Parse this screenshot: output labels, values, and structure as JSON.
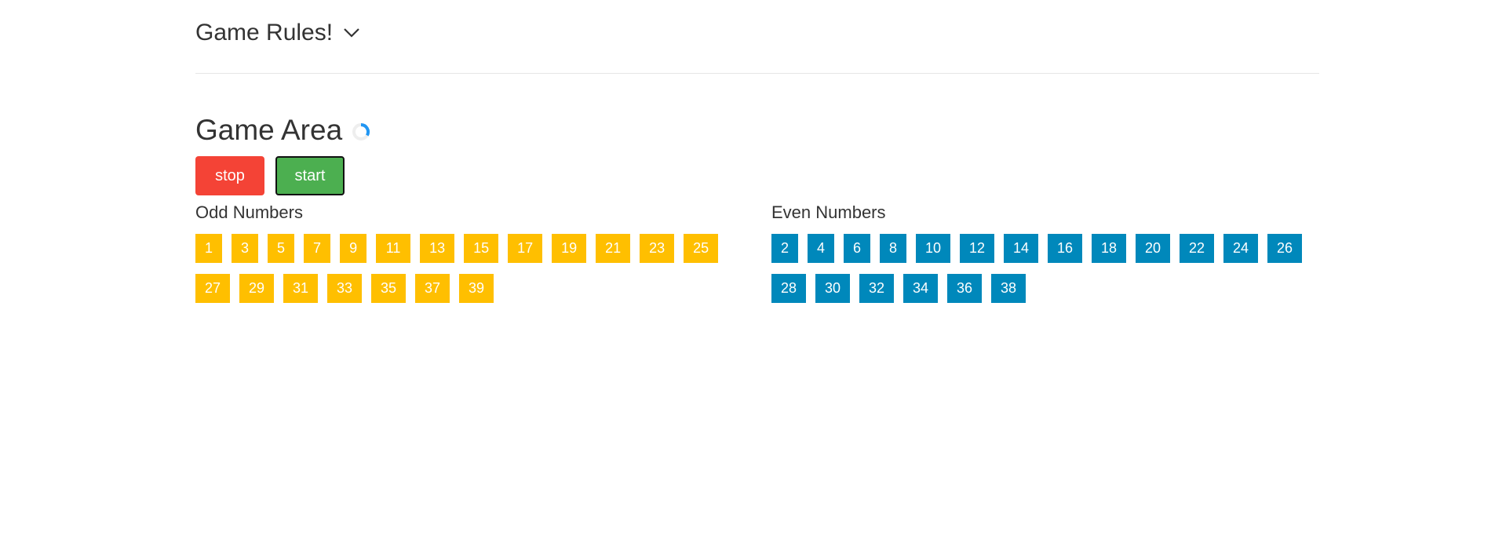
{
  "rules": {
    "title": "Game Rules!"
  },
  "game": {
    "title": "Game Area",
    "stop_label": "stop",
    "start_label": "start"
  },
  "odd": {
    "title": "Odd Numbers",
    "numbers": [
      "1",
      "3",
      "5",
      "7",
      "9",
      "11",
      "13",
      "15",
      "17",
      "19",
      "21",
      "23",
      "25",
      "27",
      "29",
      "31",
      "33",
      "35",
      "37",
      "39"
    ]
  },
  "even": {
    "title": "Even Numbers",
    "numbers": [
      "2",
      "4",
      "6",
      "8",
      "10",
      "12",
      "14",
      "16",
      "18",
      "20",
      "22",
      "24",
      "26",
      "28",
      "30",
      "32",
      "34",
      "36",
      "38"
    ]
  },
  "colors": {
    "stop": "#f44336",
    "start": "#4caf50",
    "odd_tile": "#ffbf00",
    "even_tile": "#0088bb",
    "spinner": "#2196f3"
  },
  "icons": {
    "rules_toggle": "chevron-down-icon",
    "loading": "spinner-icon"
  }
}
